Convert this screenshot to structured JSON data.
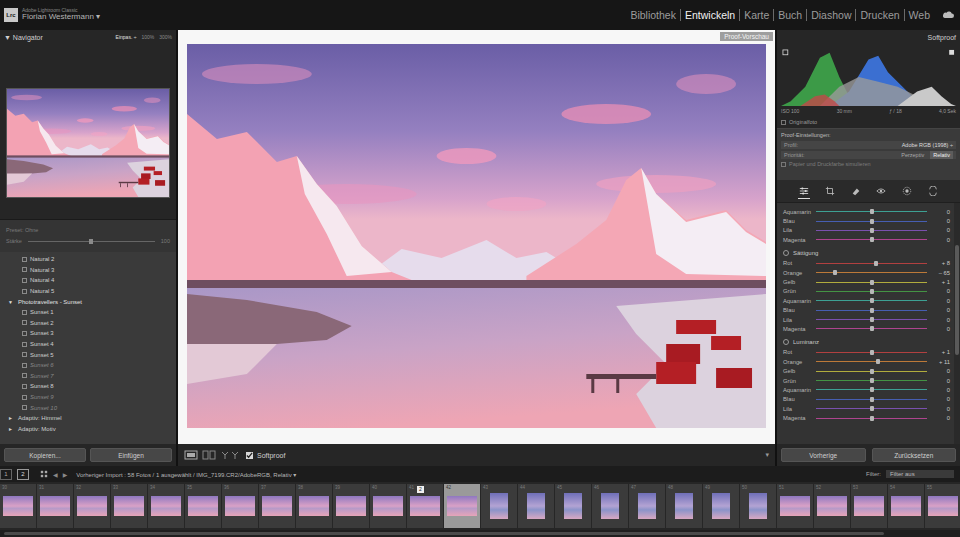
{
  "app": {
    "logo": "Lrc",
    "product": "Adobe Lightroom Classic",
    "user": "Florian Westermann",
    "user_menu": "▾"
  },
  "modules": [
    {
      "label": "Bibliothek",
      "selected": false
    },
    {
      "label": "Entwickeln",
      "selected": true
    },
    {
      "label": "Karte",
      "selected": false
    },
    {
      "label": "Buch",
      "selected": false
    },
    {
      "label": "Diashow",
      "selected": false
    },
    {
      "label": "Drucken",
      "selected": false
    },
    {
      "label": "Web",
      "selected": false
    }
  ],
  "navigator": {
    "icon": "▼",
    "title": "Navigator",
    "zoom": [
      {
        "label": "Einpas. ÷",
        "selected": true
      },
      {
        "label": "100%",
        "selected": false
      },
      {
        "label": "300%",
        "selected": false
      }
    ]
  },
  "preset_amount": {
    "preset_label": "Preset: Ohne",
    "label": "Stärke",
    "value": "100",
    "level": 0.5,
    "disabled": true
  },
  "presets": [
    {
      "label": "Natural 2",
      "kind": "item",
      "disabled": false
    },
    {
      "label": "Natural 3",
      "kind": "item",
      "disabled": false
    },
    {
      "label": "Natural 4",
      "kind": "item",
      "disabled": false
    },
    {
      "label": "Natural 5",
      "kind": "item",
      "disabled": false
    },
    {
      "label": "Phototravellers - Sunset",
      "kind": "group",
      "icon": "▼",
      "expanded": true,
      "disabled": false
    },
    {
      "label": "Sunset 1",
      "kind": "item",
      "disabled": false
    },
    {
      "label": "Sunset 2",
      "kind": "item",
      "disabled": false
    },
    {
      "label": "Sunset 3",
      "kind": "item",
      "disabled": false
    },
    {
      "label": "Sunset 4",
      "kind": "item",
      "disabled": false
    },
    {
      "label": "Sunset 5",
      "kind": "item",
      "disabled": false
    },
    {
      "label": "Sunset 6",
      "kind": "item",
      "disabled": true
    },
    {
      "label": "Sunset 7",
      "kind": "item",
      "disabled": true
    },
    {
      "label": "Sunset 8",
      "kind": "item",
      "disabled": false
    },
    {
      "label": "Sunset 9",
      "kind": "item",
      "disabled": true
    },
    {
      "label": "Sunset 10",
      "kind": "item",
      "disabled": true
    },
    {
      "label": "Adaptiv: Himmel",
      "kind": "group",
      "icon": "►",
      "expanded": false,
      "disabled": false
    },
    {
      "label": "Adaptiv: Motiv",
      "kind": "group",
      "icon": "►",
      "expanded": false,
      "disabled": false
    }
  ],
  "left_buttons": [
    "Kopieren...",
    "Einfügen"
  ],
  "center": {
    "proof_badge": "Proof-Vorschau",
    "softproof": {
      "label": "Softproof",
      "checked": true
    },
    "toolbar_menu": "▾"
  },
  "right": {
    "title": "Softproof",
    "exif": [
      "ISO 100",
      "30 mm",
      "ƒ / 18",
      "4,0 Sek"
    ],
    "original": {
      "label": "Originalfoto",
      "checked": false
    },
    "proof": {
      "title": "Proof-Einstellungen:",
      "profile_label": "Profil:",
      "profile": "Adobe RGB (1998)",
      "profile_arrow": "÷",
      "intent_label": "Priorität:",
      "intents": [
        {
          "label": "Perzeptiv",
          "selected": false
        },
        {
          "label": "Relativ",
          "selected": true
        }
      ],
      "simulate": {
        "label": "Papier und Druckfarbe simulieren",
        "checked": false,
        "disabled": true
      }
    },
    "tools": [
      {
        "kind": "adjust",
        "selected": true
      },
      {
        "kind": "crop",
        "selected": false
      },
      {
        "kind": "heal",
        "selected": false
      },
      {
        "kind": "redeye",
        "selected": false
      },
      {
        "kind": "mask",
        "selected": false
      },
      {
        "kind": "transform",
        "selected": false
      }
    ],
    "hsl": [
      {
        "rows": [
          {
            "label": "Aquamarin",
            "value": "0",
            "level": 0.5,
            "color": "#3fb3a4"
          },
          {
            "label": "Blau",
            "value": "0",
            "level": 0.5,
            "color": "#4a66c8"
          },
          {
            "label": "Lila",
            "value": "0",
            "level": 0.5,
            "color": "#8756c4"
          },
          {
            "label": "Magenta",
            "value": "0",
            "level": 0.5,
            "color": "#c4479f"
          }
        ]
      },
      {
        "title": "Sättigung",
        "rows": [
          {
            "label": "Rot",
            "value": "+ 8",
            "level": 0.54,
            "color": "#c94343"
          },
          {
            "label": "Orange",
            "value": "– 65",
            "level": 0.175,
            "color": "#d4863a"
          },
          {
            "label": "Gelb",
            "value": "+ 1",
            "level": 0.505,
            "color": "#c9c23f"
          },
          {
            "label": "Grün",
            "value": "0",
            "level": 0.5,
            "color": "#47a447"
          },
          {
            "label": "Aquamarin",
            "value": "0",
            "level": 0.5,
            "color": "#3fb3a4"
          },
          {
            "label": "Blau",
            "value": "0",
            "level": 0.5,
            "color": "#4a66c8"
          },
          {
            "label": "Lila",
            "value": "0",
            "level": 0.5,
            "color": "#8756c4"
          },
          {
            "label": "Magenta",
            "value": "0",
            "level": 0.5,
            "color": "#c4479f"
          }
        ]
      },
      {
        "title": "Luminanz",
        "rows": [
          {
            "label": "Rot",
            "value": "+ 1",
            "level": 0.505,
            "color": "#c94343"
          },
          {
            "label": "Orange",
            "value": "+ 11",
            "level": 0.555,
            "color": "#d4863a"
          },
          {
            "label": "Gelb",
            "value": "0",
            "level": 0.5,
            "color": "#c9c23f"
          },
          {
            "label": "Grün",
            "value": "0",
            "level": 0.5,
            "color": "#47a447"
          },
          {
            "label": "Aquamarin",
            "value": "0",
            "level": 0.5,
            "color": "#3fb3a4"
          },
          {
            "label": "Blau",
            "value": "0",
            "level": 0.5,
            "color": "#4a66c8"
          },
          {
            "label": "Lila",
            "value": "0",
            "level": 0.5,
            "color": "#8756c4"
          },
          {
            "label": "Magenta",
            "value": "0",
            "level": 0.5,
            "color": "#c4479f"
          }
        ]
      }
    ],
    "buttons": [
      "Vorherige",
      "Zurücksetzen"
    ]
  },
  "filmstrip": {
    "pages": [
      {
        "label": "1",
        "selected": false
      },
      {
        "label": "2",
        "selected": true
      }
    ],
    "prev": "◀",
    "next": "▶",
    "source": "Vorheriger Import : 58 Fotos / 1 ausgewählt / IMG_7199.CR2/AdobeRGB, Relativ ▾",
    "filter_label": "Filter:",
    "filter": "Filter aus",
    "thumbs": [
      {
        "index": "30",
        "selected": false,
        "badge": "",
        "kind": "landscape"
      },
      {
        "index": "31",
        "selected": false,
        "badge": "",
        "kind": "landscape"
      },
      {
        "index": "32",
        "selected": false,
        "badge": "",
        "kind": "landscape"
      },
      {
        "index": "33",
        "selected": false,
        "badge": "",
        "kind": "landscape"
      },
      {
        "index": "34",
        "selected": false,
        "badge": "",
        "kind": "landscape"
      },
      {
        "index": "35",
        "selected": false,
        "badge": "",
        "kind": "landscape"
      },
      {
        "index": "36",
        "selected": false,
        "badge": "",
        "kind": "landscape"
      },
      {
        "index": "37",
        "selected": false,
        "badge": "",
        "kind": "landscape"
      },
      {
        "index": "38",
        "selected": false,
        "badge": "",
        "kind": "landscape"
      },
      {
        "index": "39",
        "selected": false,
        "badge": "",
        "kind": "landscape"
      },
      {
        "index": "40",
        "selected": false,
        "badge": "",
        "kind": "landscape"
      },
      {
        "index": "41",
        "selected": false,
        "badge": "2",
        "kind": "landscape"
      },
      {
        "index": "42",
        "selected": true,
        "badge": "",
        "kind": "landscape"
      },
      {
        "index": "43",
        "selected": false,
        "badge": "",
        "kind": "portrait"
      },
      {
        "index": "44",
        "selected": false,
        "badge": "",
        "kind": "portrait"
      },
      {
        "index": "45",
        "selected": false,
        "badge": "",
        "kind": "portrait"
      },
      {
        "index": "46",
        "selected": false,
        "badge": "",
        "kind": "portrait"
      },
      {
        "index": "47",
        "selected": false,
        "badge": "",
        "kind": "portrait"
      },
      {
        "index": "48",
        "selected": false,
        "badge": "",
        "kind": "portrait"
      },
      {
        "index": "49",
        "selected": false,
        "badge": "",
        "kind": "portrait"
      },
      {
        "index": "50",
        "selected": false,
        "badge": "",
        "kind": "portrait"
      },
      {
        "index": "51",
        "selected": false,
        "badge": "",
        "kind": "landscape"
      },
      {
        "index": "52",
        "selected": false,
        "badge": "",
        "kind": "landscape"
      },
      {
        "index": "53",
        "selected": false,
        "badge": "",
        "kind": "landscape"
      },
      {
        "index": "54",
        "selected": false,
        "badge": "",
        "kind": "landscape"
      },
      {
        "index": "55",
        "selected": false,
        "badge": "",
        "kind": "landscape"
      }
    ]
  }
}
